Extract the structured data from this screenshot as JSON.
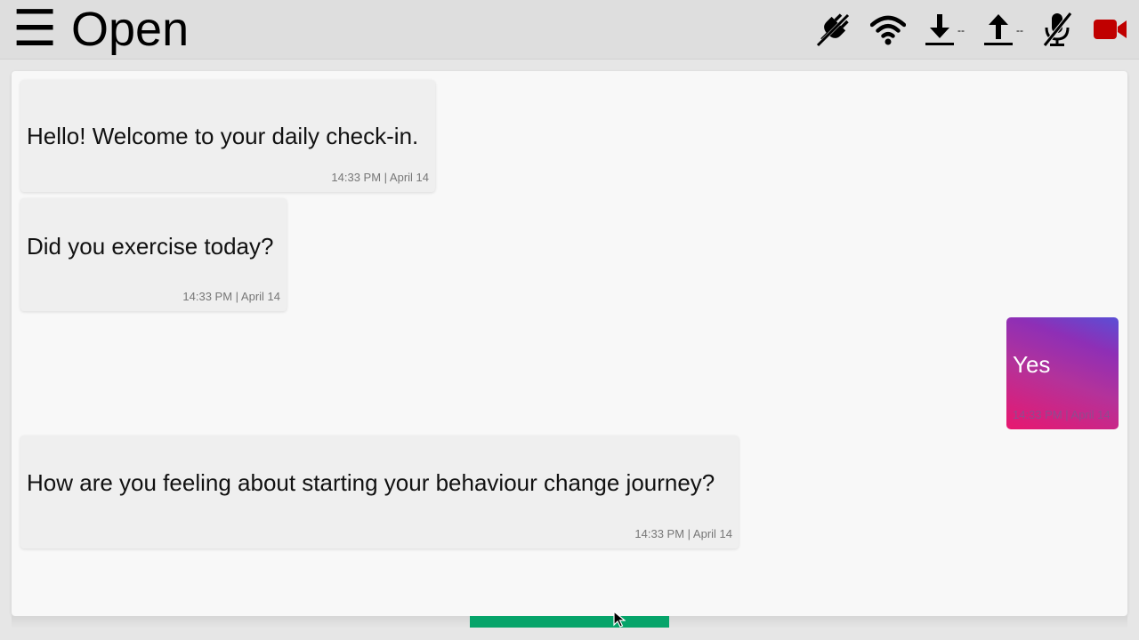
{
  "header": {
    "menu_icon": "☰",
    "title": "Open",
    "status": {
      "connection_icon": "plug-off-icon",
      "wifi_icon": "wifi-icon",
      "download_icon": "download-arrow-icon",
      "download_rate": "--",
      "upload_icon": "upload-arrow-icon",
      "upload_rate": "--",
      "mic_icon": "mic-off-icon",
      "camera_icon": "video-camera-icon"
    }
  },
  "colors": {
    "camera_red": "#c00000",
    "send_bar_green": "#06a46a",
    "user_bubble_gradient": [
      "#e8176f",
      "#8e2fb6",
      "#5a4fd6"
    ]
  },
  "messages": [
    {
      "sender": "bot",
      "text": "Hello! Welcome to your daily check-in.",
      "time": "14:33 PM | April 14"
    },
    {
      "sender": "bot",
      "text": "Did you exercise today?",
      "time": "14:33 PM | April 14"
    },
    {
      "sender": "user",
      "text": "Yes",
      "time": "14:33 PM | April 14"
    },
    {
      "sender": "bot",
      "text": "How are you feeling about starting your behaviour change journey?",
      "time": "14:33 PM | April 14"
    }
  ]
}
